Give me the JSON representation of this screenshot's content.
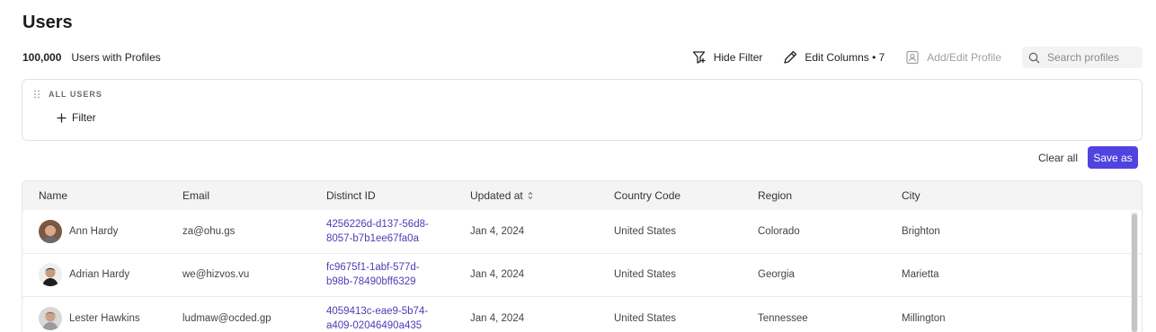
{
  "page": {
    "title": "Users"
  },
  "summary": {
    "count": "100,000",
    "label": "Users with Profiles"
  },
  "toolbar": {
    "hide_filter": "Hide Filter",
    "edit_columns": "Edit Columns • 7",
    "add_edit_profile": "Add/Edit Profile",
    "search_placeholder": "Search profiles"
  },
  "filter_panel": {
    "group_label": "ALL USERS",
    "add_filter": "Filter"
  },
  "actions": {
    "clear_all": "Clear all",
    "save_as": "Save as"
  },
  "table": {
    "columns": [
      "Name",
      "Email",
      "Distinct ID",
      "Updated at",
      "Country Code",
      "Region",
      "City"
    ],
    "rows": [
      {
        "name": "Ann Hardy",
        "email": "za@ohu.gs",
        "id1": "4256226d-d137-56d8-",
        "id2": "8057-b7b1ee67fa0a",
        "updated": "Jan 4, 2024",
        "country": "United States",
        "region": "Colorado",
        "city": "Brighton"
      },
      {
        "name": "Adrian Hardy",
        "email": "we@hizvos.vu",
        "id1": "fc9675f1-1abf-577d-",
        "id2": "b98b-78490bff6329",
        "updated": "Jan 4, 2024",
        "country": "United States",
        "region": "Georgia",
        "city": "Marietta"
      },
      {
        "name": "Lester Hawkins",
        "email": "ludmaw@ocded.gp",
        "id1": "4059413c-eae9-5b74-",
        "id2": "a409-02046490a435",
        "updated": "Jan 4, 2024",
        "country": "United States",
        "region": "Tennessee",
        "city": "Millington"
      }
    ]
  },
  "colors": {
    "accent": "#4f44e0",
    "link": "#4a3fb5"
  }
}
